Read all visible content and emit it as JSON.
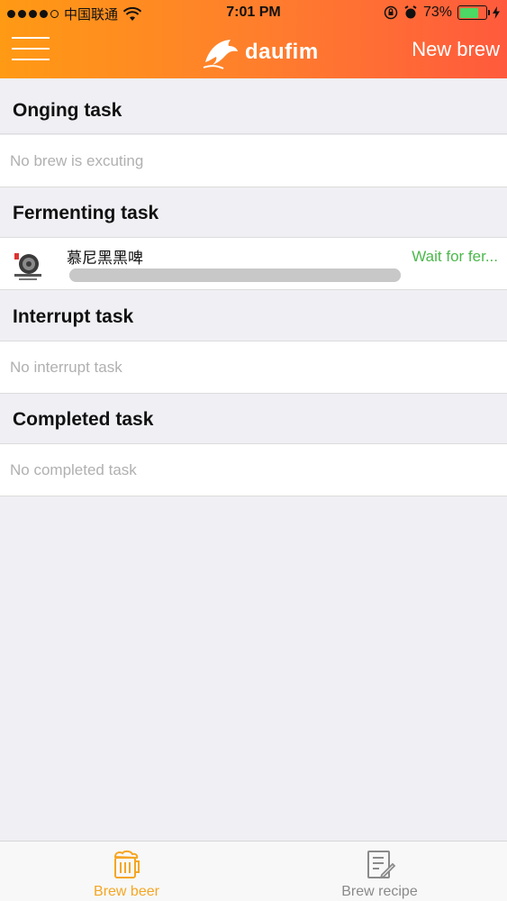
{
  "status_bar": {
    "carrier": "中国联通",
    "time": "7:01 PM",
    "battery": "73%",
    "battery_level": 0.73
  },
  "nav": {
    "brand": "daufim",
    "new_brew": "New brew"
  },
  "sections": {
    "ongoing": {
      "title": "Onging task",
      "empty": "No brew is excuting"
    },
    "fermenting": {
      "title": "Fermenting task",
      "task": {
        "name": "慕尼黑黑啤",
        "status": "Wait for fer...",
        "progress": 1.0
      }
    },
    "interrupt": {
      "title": "Interrupt task",
      "empty": "No interrupt task"
    },
    "completed": {
      "title": "Completed task",
      "empty": "No completed task"
    }
  },
  "tabs": {
    "brew_beer": "Brew beer",
    "brew_recipe": "Brew recipe"
  },
  "colors": {
    "accent": "#f5a623",
    "status_green": "#4cb84c",
    "header_start": "#ff9a14",
    "header_end": "#ff5a3d"
  }
}
